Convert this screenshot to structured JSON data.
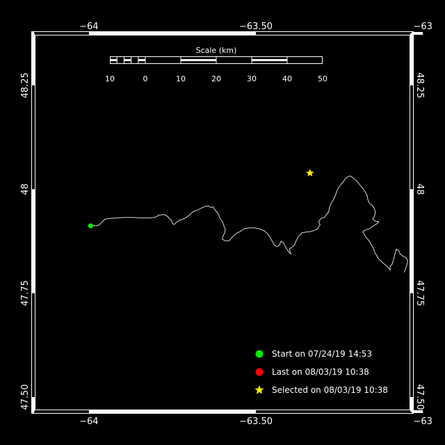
{
  "map": {
    "x_ticks": [
      {
        "value": -64,
        "label": "−64"
      },
      {
        "value": -63.5,
        "label": "−63.50"
      },
      {
        "value": -63,
        "label": "−63"
      }
    ],
    "y_ticks": [
      {
        "value": 48.25,
        "label": "48.25"
      },
      {
        "value": 48,
        "label": "48"
      },
      {
        "value": 47.75,
        "label": "47.75"
      },
      {
        "value": 47.5,
        "label": "47.50"
      }
    ],
    "lon_range": [
      -64.16,
      -63.04
    ],
    "lat_range": [
      47.47,
      48.37
    ],
    "colors": {
      "background": "#000000",
      "frame": "#ffffff",
      "track": "#d9d9d9",
      "start": "#00ee00",
      "last": "#ff0000",
      "selected": "#ffee00"
    }
  },
  "scale_bar": {
    "title": "Scale (km)",
    "labels": [
      "10",
      "0",
      "10",
      "20",
      "30",
      "40",
      "50"
    ]
  },
  "legend": {
    "start_label": "Start on 07/24/19 14:53",
    "last_label": "Last on 08/03/19 10:38",
    "selected_label": "Selected on 08/03/19 10:38"
  },
  "track": {
    "start": [
      -63.995,
      47.912
    ],
    "selected": [
      -63.338,
      48.039
    ],
    "points": [
      [
        -63.995,
        47.912
      ],
      [
        -63.985,
        47.912
      ],
      [
        -63.975,
        47.912
      ],
      [
        -63.968,
        47.915
      ],
      [
        -63.96,
        47.922
      ],
      [
        -63.952,
        47.928
      ],
      [
        -63.935,
        47.93
      ],
      [
        -63.915,
        47.931
      ],
      [
        -63.895,
        47.932
      ],
      [
        -63.87,
        47.932
      ],
      [
        -63.84,
        47.931
      ],
      [
        -63.815,
        47.931
      ],
      [
        -63.8,
        47.933
      ],
      [
        -63.79,
        47.938
      ],
      [
        -63.775,
        47.939
      ],
      [
        -63.765,
        47.935
      ],
      [
        -63.758,
        47.929
      ],
      [
        -63.752,
        47.924
      ],
      [
        -63.75,
        47.918
      ],
      [
        -63.745,
        47.915
      ],
      [
        -63.74,
        47.919
      ],
      [
        -63.73,
        47.925
      ],
      [
        -63.715,
        47.929
      ],
      [
        -63.7,
        47.937
      ],
      [
        -63.688,
        47.946
      ],
      [
        -63.67,
        47.952
      ],
      [
        -63.655,
        47.958
      ],
      [
        -63.642,
        47.96
      ],
      [
        -63.635,
        47.956
      ],
      [
        -63.628,
        47.958
      ],
      [
        -63.625,
        47.953
      ],
      [
        -63.618,
        47.946
      ],
      [
        -63.612,
        47.94
      ],
      [
        -63.608,
        47.93
      ],
      [
        -63.6,
        47.922
      ],
      [
        -63.596,
        47.912
      ],
      [
        -63.592,
        47.905
      ],
      [
        -63.593,
        47.896
      ],
      [
        -63.598,
        47.888
      ],
      [
        -63.601,
        47.88
      ],
      [
        -63.592,
        47.876
      ],
      [
        -63.58,
        47.876
      ],
      [
        -63.572,
        47.884
      ],
      [
        -63.56,
        47.893
      ],
      [
        -63.548,
        47.898
      ],
      [
        -63.535,
        47.905
      ],
      [
        -63.52,
        47.907
      ],
      [
        -63.505,
        47.907
      ],
      [
        -63.49,
        47.905
      ],
      [
        -63.475,
        47.9
      ],
      [
        -63.465,
        47.893
      ],
      [
        -63.458,
        47.885
      ],
      [
        -63.452,
        47.876
      ],
      [
        -63.445,
        47.866
      ],
      [
        -63.437,
        47.862
      ],
      [
        -63.43,
        47.865
      ],
      [
        -63.425,
        47.875
      ],
      [
        -63.418,
        47.872
      ],
      [
        -63.412,
        47.862
      ],
      [
        -63.405,
        47.853
      ],
      [
        -63.4,
        47.847
      ],
      [
        -63.395,
        47.844
      ],
      [
        -63.4,
        47.856
      ],
      [
        -63.393,
        47.86
      ],
      [
        -63.385,
        47.865
      ],
      [
        -63.38,
        47.875
      ],
      [
        -63.372,
        47.887
      ],
      [
        -63.362,
        47.895
      ],
      [
        -63.35,
        47.897
      ],
      [
        -63.338,
        47.898
      ],
      [
        -63.325,
        47.901
      ],
      [
        -63.315,
        47.905
      ],
      [
        -63.308,
        47.915
      ],
      [
        -63.312,
        47.922
      ],
      [
        -63.305,
        47.93
      ],
      [
        -63.295,
        47.932
      ],
      [
        -63.288,
        47.94
      ],
      [
        -63.282,
        47.946
      ],
      [
        -63.28,
        47.956
      ],
      [
        -63.275,
        47.966
      ],
      [
        -63.268,
        47.975
      ],
      [
        -63.262,
        47.985
      ],
      [
        -63.258,
        47.995
      ],
      [
        -63.252,
        48.005
      ],
      [
        -63.245,
        48.012
      ],
      [
        -63.238,
        48.018
      ],
      [
        -63.232,
        48.026
      ],
      [
        -63.225,
        48.03
      ],
      [
        -63.218,
        48.032
      ],
      [
        -63.212,
        48.029
      ],
      [
        -63.205,
        48.025
      ],
      [
        -63.198,
        48.02
      ],
      [
        -63.19,
        48.012
      ],
      [
        -63.18,
        48.002
      ],
      [
        -63.172,
        47.993
      ],
      [
        -63.167,
        47.985
      ],
      [
        -63.165,
        47.975
      ],
      [
        -63.16,
        47.966
      ],
      [
        -63.15,
        47.96
      ],
      [
        -63.145,
        47.952
      ],
      [
        -63.142,
        47.945
      ],
      [
        -63.145,
        47.935
      ],
      [
        -63.15,
        47.928
      ],
      [
        -63.142,
        47.923
      ],
      [
        -63.132,
        47.922
      ],
      [
        -63.136,
        47.918
      ],
      [
        -63.148,
        47.912
      ],
      [
        -63.16,
        47.905
      ],
      [
        -63.172,
        47.902
      ],
      [
        -63.18,
        47.898
      ],
      [
        -63.175,
        47.89
      ],
      [
        -63.168,
        47.882
      ],
      [
        -63.16,
        47.875
      ],
      [
        -63.155,
        47.867
      ],
      [
        -63.148,
        47.858
      ],
      [
        -63.145,
        47.849
      ],
      [
        -63.138,
        47.84
      ],
      [
        -63.132,
        47.832
      ],
      [
        -63.12,
        47.823
      ],
      [
        -63.108,
        47.815
      ],
      [
        -63.1,
        47.808
      ],
      [
        -63.098,
        47.805
      ],
      [
        -63.098,
        47.814
      ],
      [
        -63.092,
        47.82
      ],
      [
        -63.088,
        47.83
      ],
      [
        -63.085,
        47.84
      ],
      [
        -63.082,
        47.85
      ],
      [
        -63.08,
        47.856
      ],
      [
        -63.072,
        47.852
      ],
      [
        -63.068,
        47.844
      ],
      [
        -63.06,
        47.839
      ],
      [
        -63.05,
        47.835
      ],
      [
        -63.045,
        47.828
      ],
      [
        -63.048,
        47.818
      ],
      [
        -63.052,
        47.808
      ],
      [
        -63.056,
        47.8
      ]
    ]
  }
}
